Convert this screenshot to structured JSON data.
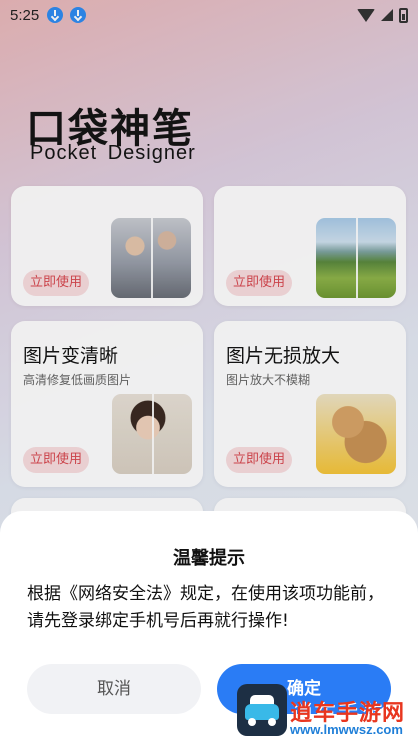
{
  "status_bar": {
    "time": "5:25"
  },
  "header": {
    "title": "口袋神笔",
    "subtitle": "Pocket Designer"
  },
  "cards": [
    {
      "title": "",
      "desc": "",
      "button": "立即使用",
      "thumb": "people-photo"
    },
    {
      "title": "",
      "desc": "",
      "button": "立即使用",
      "thumb": "landscape-photo"
    },
    {
      "title": "图片变清晰",
      "desc": "高清修复低画质图片",
      "button": "立即使用",
      "thumb": "portrait-photo"
    },
    {
      "title": "图片无损放大",
      "desc": "图片放大不模糊",
      "button": "立即使用",
      "thumb": "cat-photo"
    }
  ],
  "dialog": {
    "title": "温馨提示",
    "message": "根据《网络安全法》规定，在使用该项功能前，请先登录绑定手机号后再就行操作!",
    "cancel_label": "取消",
    "confirm_label": "确定"
  },
  "watermark": {
    "text": "逍车手游网",
    "url": "www.lmwwsz.com"
  },
  "colors": {
    "primary": "#2a7cf5",
    "use_button_bg": "#f8dcdf",
    "use_button_text": "#d8484f"
  }
}
